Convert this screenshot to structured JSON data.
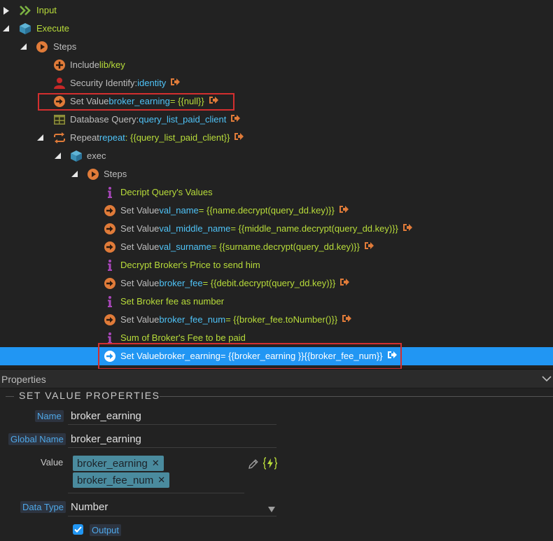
{
  "tree": {
    "rows": [
      {
        "prefix": "",
        "main": "Input",
        "suffix": ""
      },
      {
        "prefix": "",
        "main": "Execute",
        "suffix": ""
      },
      {
        "prefix": "Steps",
        "main": "",
        "suffix": ""
      },
      {
        "prefix": "Include ",
        "main": "lib/key",
        "suffix": ""
      },
      {
        "prefix": "Security Identify: ",
        "main": "identity",
        "suffix": ""
      },
      {
        "prefix": "Set Value ",
        "main": "broker_earning",
        "suffix": " = {{null}}"
      },
      {
        "prefix": "Database Query: ",
        "main": "query_list_paid_client",
        "suffix": ""
      },
      {
        "prefix": "Repeat ",
        "main": "repeat",
        "suffix": ": {{query_list_paid_client}}"
      },
      {
        "prefix": "exec",
        "main": "",
        "suffix": ""
      },
      {
        "prefix": "Steps",
        "main": "",
        "suffix": ""
      },
      {
        "prefix": "",
        "main": "Decript Query's Values",
        "suffix": ""
      },
      {
        "prefix": "Set Value ",
        "main": "val_name",
        "suffix": " = {{name.decrypt(query_dd.key)}}"
      },
      {
        "prefix": "Set Value ",
        "main": "val_middle_name",
        "suffix": " = {{middle_name.decrypt(query_dd.key)}}"
      },
      {
        "prefix": "Set Value ",
        "main": "val_surname",
        "suffix": " = {{surname.decrypt(query_dd.key)}}"
      },
      {
        "prefix": "",
        "main": "Decrypt Broker's Price to send him",
        "suffix": ""
      },
      {
        "prefix": "Set Value ",
        "main": "broker_fee",
        "suffix": " = {{debit.decrypt(query_dd.key)}}"
      },
      {
        "prefix": "",
        "main": "Set Broker fee as number",
        "suffix": ""
      },
      {
        "prefix": "Set Value ",
        "main": "broker_fee_num",
        "suffix": " = {{broker_fee.toNumber()}}"
      },
      {
        "prefix": "",
        "main": "Sum of Broker's Fee to be paid",
        "suffix": ""
      },
      {
        "prefix": "Set Value ",
        "main": "broker_earning",
        "suffix": " = {{broker_earning }}{{broker_fee_num}}"
      }
    ]
  },
  "properties": {
    "header": "Properties",
    "section_title": "SET VALUE PROPERTIES",
    "name_label": "Name",
    "name_value": "broker_earning",
    "global_name_label": "Global Name",
    "global_name_value": "broker_earning",
    "value_label": "Value",
    "value_tags": [
      "broker_earning",
      "broker_fee_num"
    ],
    "data_type_label": "Data Type",
    "data_type_value": "Number",
    "output_label": "Output",
    "output_checked": true
  },
  "colors": {
    "accent": "#2196f3",
    "highlight_box": "#d32f2f",
    "label_green": "#b8dc3a",
    "label_cyan": "#4fc3f7",
    "icon_orange": "#e07b39"
  }
}
